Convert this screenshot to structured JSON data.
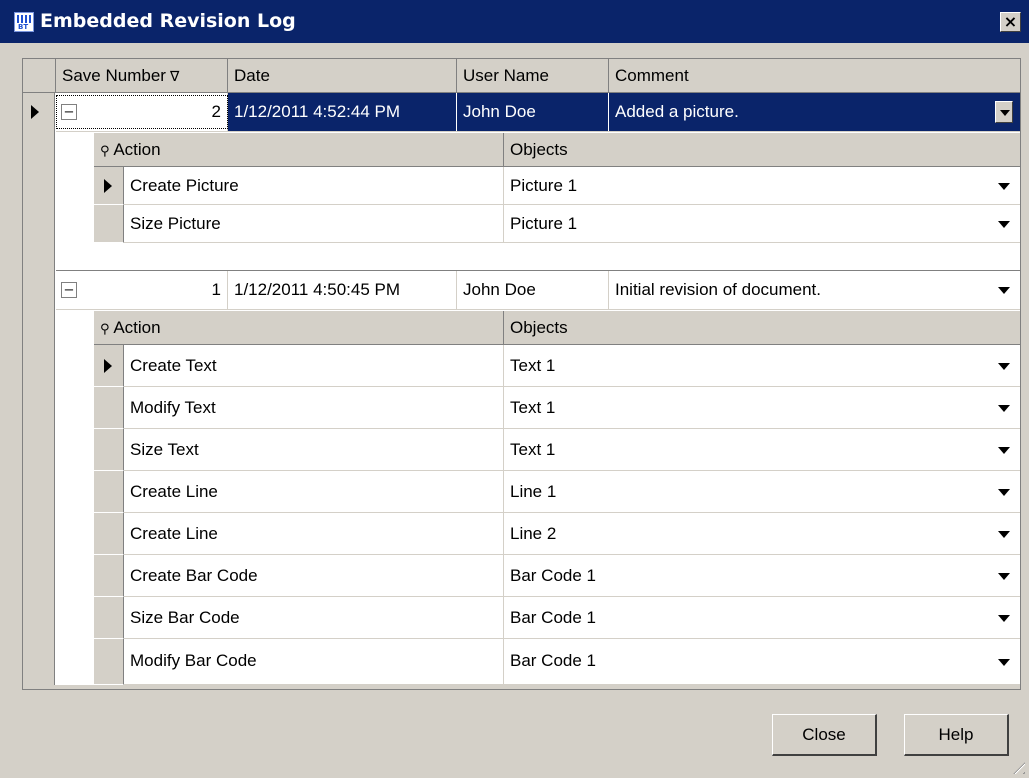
{
  "window": {
    "title": "Embedded Revision Log",
    "close_glyph": "×"
  },
  "grid": {
    "columns": [
      "Save Number",
      "Date",
      "User Name",
      "Comment"
    ],
    "sort_glyph": "∇",
    "records": [
      {
        "save_number": "2",
        "date": "1/12/2011 4:52:44 PM",
        "user": "John Doe",
        "comment": "Added a picture.",
        "expand_glyph": "−",
        "child_columns": [
          "Action",
          "Objects"
        ],
        "actions": [
          {
            "action": "Create Picture",
            "objects": "Picture 1"
          },
          {
            "action": "Size Picture",
            "objects": "Picture 1"
          }
        ]
      },
      {
        "save_number": "1",
        "date": "1/12/2011 4:50:45 PM",
        "user": "John Doe",
        "comment": "Initial revision of document.",
        "expand_glyph": "−",
        "child_columns": [
          "Action",
          "Objects"
        ],
        "actions": [
          {
            "action": "Create Text",
            "objects": "Text 1"
          },
          {
            "action": "Modify Text",
            "objects": "Text 1"
          },
          {
            "action": "Size Text",
            "objects": "Text 1"
          },
          {
            "action": "Create Line",
            "objects": "Line 1"
          },
          {
            "action": "Create Line",
            "objects": "Line 2"
          },
          {
            "action": "Create Bar Code",
            "objects": "Bar Code 1"
          },
          {
            "action": "Size Bar Code",
            "objects": "Bar Code 1"
          },
          {
            "action": "Modify Bar Code",
            "objects": "Bar Code 1"
          }
        ]
      }
    ]
  },
  "buttons": {
    "close": "Close",
    "help": "Help"
  },
  "colors": {
    "selection": "#0a246a",
    "face": "#d4d0c8"
  },
  "icons": {
    "search": "magnifier-icon",
    "app": "bartender-icon"
  }
}
